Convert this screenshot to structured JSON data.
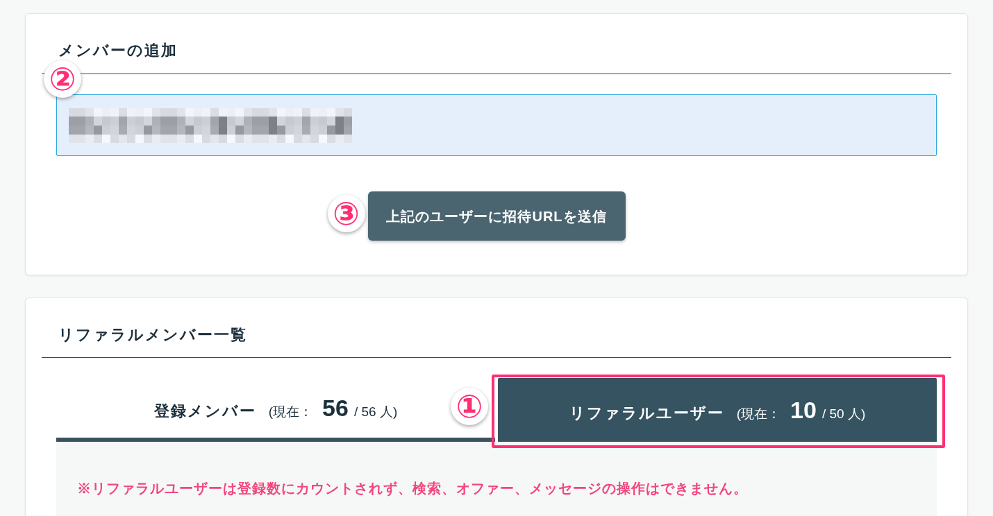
{
  "add_member": {
    "title": "メンバーの追加",
    "marker": "②",
    "input": {
      "redacted": true
    },
    "send_button": {
      "label": "上記のユーザーに招待URLを送信",
      "marker": "③"
    }
  },
  "referral_members": {
    "title": "リファラルメンバー一覧",
    "tabs": [
      {
        "label": "登録メンバー",
        "count_prefix": "(現在：",
        "current": "56",
        "limit": "/ 56 人)",
        "selected": false,
        "highlighted": false
      },
      {
        "label": "リファラルユーザー",
        "count_prefix": "(現在：",
        "current": "10",
        "limit": "/ 50 人)",
        "selected": true,
        "highlighted": true,
        "marker": "①"
      }
    ],
    "notice": "※リファラルユーザーは登録数にカウントされず、検索、オファー、メッセージの操作はできません。"
  }
}
